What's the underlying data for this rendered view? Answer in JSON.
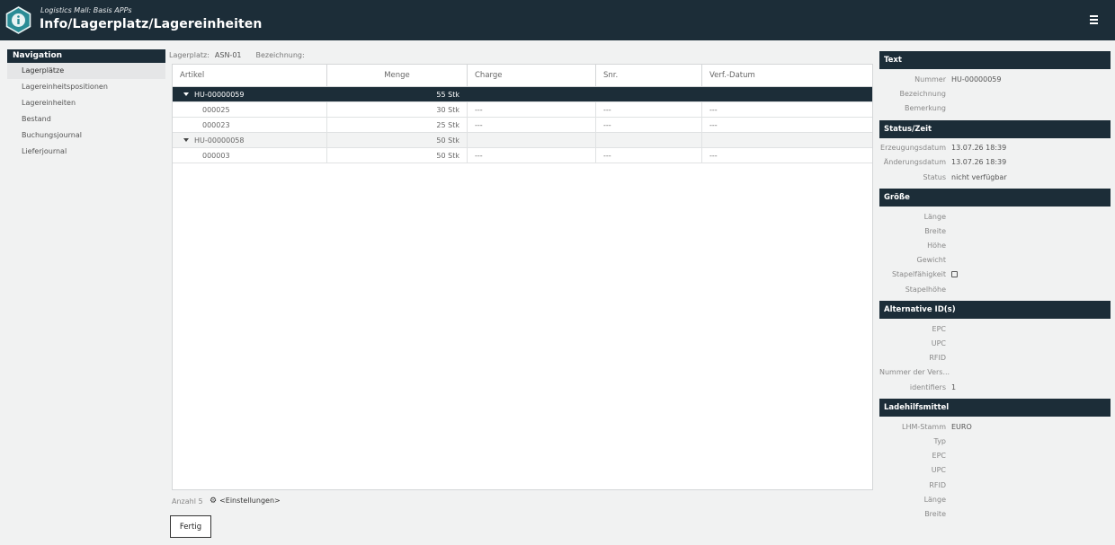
{
  "header": {
    "subtitle": "Logistics Mall: Basis APPs",
    "title": "Info/Lagerplatz/Lagereinheiten",
    "logo_icon": "info-hexagon-icon",
    "menu_icon": "hamburger-menu-icon"
  },
  "nav": {
    "title": "Navigation",
    "items": [
      {
        "label": "Lagerplätze",
        "active": true
      },
      {
        "label": "Lagereinheitspositionen"
      },
      {
        "label": "Lagereinheiten"
      },
      {
        "label": "Bestand"
      },
      {
        "label": "Buchungsjournal"
      },
      {
        "label": "Lieferjournal"
      }
    ]
  },
  "info": {
    "lagerplatz_label": "Lagerplatz:",
    "lagerplatz_value": "ASN-01",
    "bezeichnung_label": "Bezeichnung:"
  },
  "table": {
    "columns": [
      "Artikel",
      "Menge",
      "Charge",
      "Snr.",
      "Verf.-Datum"
    ],
    "rows": [
      {
        "type": "group",
        "selected": true,
        "artikel": "HU-00000059",
        "menge": "55 Stk",
        "charge": "",
        "snr": "",
        "datum": ""
      },
      {
        "type": "item",
        "artikel": "000025",
        "menge": "30 Stk",
        "charge": "---",
        "snr": "---",
        "datum": "---"
      },
      {
        "type": "item",
        "artikel": "000023",
        "menge": "25 Stk",
        "charge": "---",
        "snr": "---",
        "datum": "---"
      },
      {
        "type": "group",
        "artikel": "HU-00000058",
        "menge": "50 Stk",
        "charge": "",
        "snr": "",
        "datum": ""
      },
      {
        "type": "item",
        "artikel": "000003",
        "menge": "50 Stk",
        "charge": "---",
        "snr": "---",
        "datum": "---"
      }
    ]
  },
  "footer": {
    "count": "Anzahl 5",
    "settings": "<Einstellungen>",
    "fertig": "Fertig"
  },
  "panel": {
    "text": {
      "title": "Text",
      "fields": [
        {
          "k": "Nummer",
          "v": "HU-00000059"
        },
        {
          "k": "Bezeichnung",
          "v": ""
        },
        {
          "k": "Bemerkung",
          "v": ""
        }
      ]
    },
    "status": {
      "title": "Status/Zeit",
      "fields": [
        {
          "k": "Erzeugungsdatum",
          "v": "13.07.26 18:39"
        },
        {
          "k": "Änderungsdatum",
          "v": "13.07.26 18:39"
        },
        {
          "k": "Status",
          "v": "nicht verfügbar"
        }
      ]
    },
    "groesse": {
      "title": "Größe",
      "fields": [
        {
          "k": "Länge",
          "v": ""
        },
        {
          "k": "Breite",
          "v": ""
        },
        {
          "k": "Höhe",
          "v": ""
        },
        {
          "k": "Gewicht",
          "v": ""
        },
        {
          "k": "Stapelfähigkeit",
          "v": ""
        },
        {
          "k": "Stapelhöhe",
          "v": ""
        }
      ]
    },
    "alt_ids": {
      "title": "Alternative ID(s)",
      "fields": [
        {
          "k": "EPC",
          "v": ""
        },
        {
          "k": "UPC",
          "v": ""
        },
        {
          "k": "RFID",
          "v": ""
        },
        {
          "k": "Nummer der Vers...",
          "v": ""
        },
        {
          "k": "identifiers",
          "v": "1"
        }
      ]
    },
    "lhm": {
      "title": "Ladehilfsmittel",
      "fields": [
        {
          "k": "LHM-Stamm",
          "v": "EURO"
        },
        {
          "k": "Typ",
          "v": ""
        },
        {
          "k": "EPC",
          "v": ""
        },
        {
          "k": "UPC",
          "v": ""
        },
        {
          "k": "RFID",
          "v": ""
        },
        {
          "k": "Länge",
          "v": ""
        },
        {
          "k": "Breite",
          "v": ""
        }
      ]
    }
  },
  "colors": {
    "header_bg": "#1c2d38",
    "logo_teal": "#2a8c96",
    "page_bg": "#f1f2f2"
  }
}
